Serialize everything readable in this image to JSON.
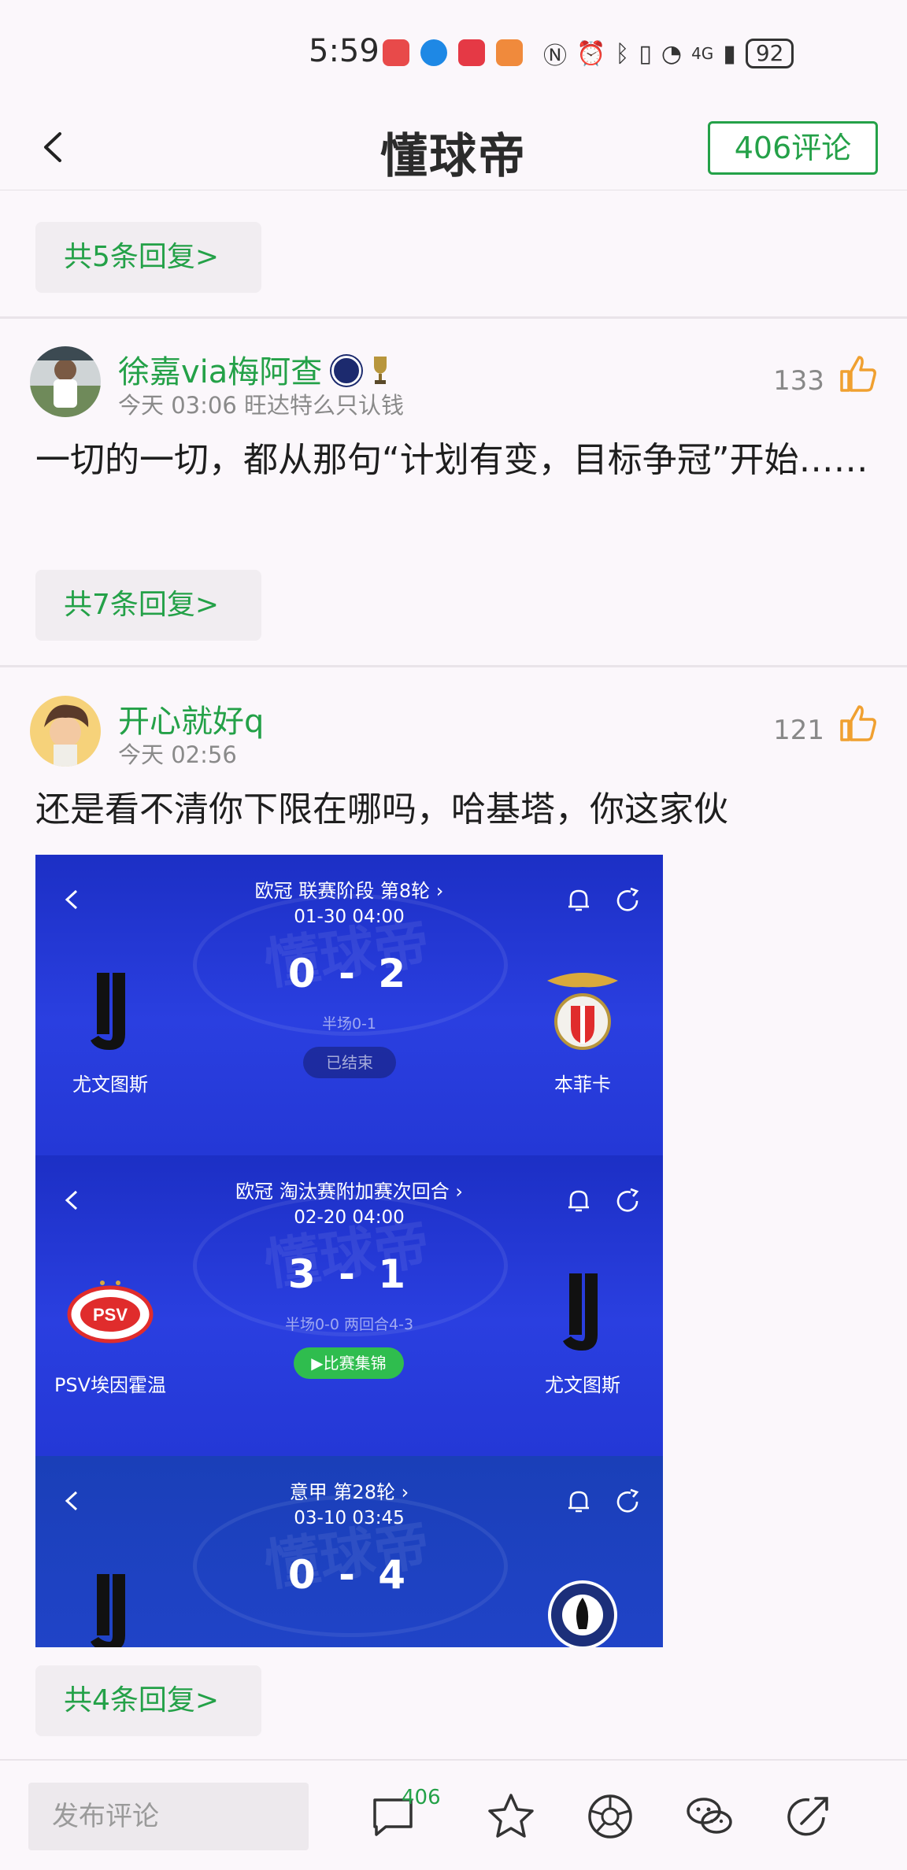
{
  "status_bar": {
    "time": "5:59",
    "battery": "92",
    "network": "4G"
  },
  "header": {
    "title": "懂球帝",
    "comment_button": "406评论"
  },
  "prev_comment": {
    "reply_button": "共5条回复>"
  },
  "comments": [
    {
      "username": "徐嘉via梅阿查",
      "meta": "今天 03:06 旺达特么只认钱",
      "likes": "133",
      "text": "一切的一切，都从那句“计划有变，目标争冠”开始……",
      "reply_button": "共7条回复>"
    },
    {
      "username": "开心就好q",
      "meta": "今天 02:56",
      "likes": "121",
      "text": "还是看不清你下限在哪吗，哈基塔，你这家伙",
      "reply_button": "共4条回复>"
    }
  ],
  "embed_cards": [
    {
      "league": "欧冠 联赛阶段 第8轮 ›",
      "date": "01-30 04:00",
      "score": "0 - 2",
      "sub": "半场0-1",
      "status": "已结束",
      "home": "尤文图斯",
      "away": "本菲卡"
    },
    {
      "league": "欧冠 淘汰赛附加赛次回合 ›",
      "date": "02-20 04:00",
      "score": "3 - 1",
      "sub": "半场0-0 两回合4-3",
      "status": "▶比赛集锦",
      "home": "PSV埃因霍温",
      "away": "尤文图斯"
    },
    {
      "league": "意甲 第28轮 ›",
      "date": "03-10 03:45",
      "score": "0 - 4"
    }
  ],
  "bottom_bar": {
    "input_placeholder": "发布评论",
    "comment_count": "406"
  },
  "colors": {
    "accent": "#24a148",
    "card_blue": "#2438d6",
    "like_orange": "#f0a030"
  }
}
